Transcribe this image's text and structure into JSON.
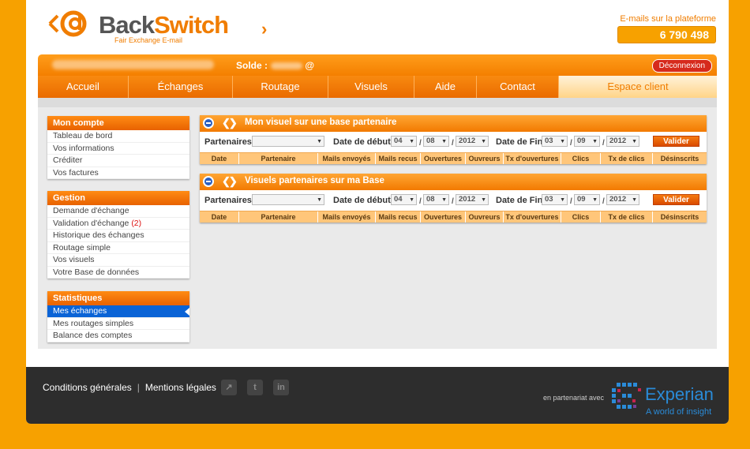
{
  "header": {
    "logo_name_a": "Back",
    "logo_name_b": "Switch",
    "logo_tagline": "Fair Exchange E-mail",
    "counter_label": "E-mails sur la plateforme",
    "counter_value": "6 790 498"
  },
  "topbar": {
    "solde_label": "Solde :",
    "solde_suffix": "@",
    "logout": "Déconnexion"
  },
  "nav": {
    "tabs": [
      "Accueil",
      "Échanges",
      "Routage",
      "Visuels",
      "Aide",
      "Contact",
      "Espace client"
    ],
    "active": "Espace client"
  },
  "sidebar": {
    "mon_compte": {
      "title": "Mon compte",
      "items": [
        "Tableau de bord",
        "Vos informations",
        "Créditer",
        "Vos factures"
      ]
    },
    "gestion": {
      "title": "Gestion",
      "items": [
        "Demande d'échange",
        "Validation d'échange",
        "Historique des échanges",
        "Routage simple",
        "Vos visuels",
        "Votre Base de données"
      ],
      "validation_count": "(2)"
    },
    "statistiques": {
      "title": "Statistiques",
      "items": [
        "Mes échanges",
        "Mes routages simples",
        "Balance des comptes"
      ],
      "active": "Mes échanges"
    }
  },
  "panels": [
    {
      "title": "Mon visuel sur une base partenaire",
      "filters": {
        "partner_label": "Partenaires",
        "start_label": "Date de début",
        "start": {
          "day": "04",
          "month": "08",
          "year": "2012"
        },
        "end_label": "Date de Fin",
        "end": {
          "day": "03",
          "month": "09",
          "year": "2012"
        },
        "button": "Valider"
      }
    },
    {
      "title": "Visuels partenaires sur ma Base",
      "filters": {
        "partner_label": "Partenaires",
        "start_label": "Date de début",
        "start": {
          "day": "04",
          "month": "08",
          "year": "2012"
        },
        "end_label": "Date de Fin",
        "end": {
          "day": "03",
          "month": "09",
          "year": "2012"
        },
        "button": "Valider"
      }
    }
  ],
  "table_columns": [
    "Date",
    "Partenaire",
    "Mails envoyés",
    "Mails recus",
    "Ouvertures",
    "Ouvreurs",
    "Tx d'ouvertures",
    "Clics",
    "Tx de clics",
    "Désinscrits"
  ],
  "footer": {
    "conditions": "Conditions générales",
    "separator": "|",
    "mentions": "Mentions légales",
    "partner_label": "en partenariat avec",
    "partner_name": "Experian",
    "partner_tagline": "A world of insight"
  },
  "colors": {
    "accent": "#f07d00",
    "background": "#f7a100",
    "footer": "#2d2d2d",
    "active_item": "#0a63d6"
  }
}
